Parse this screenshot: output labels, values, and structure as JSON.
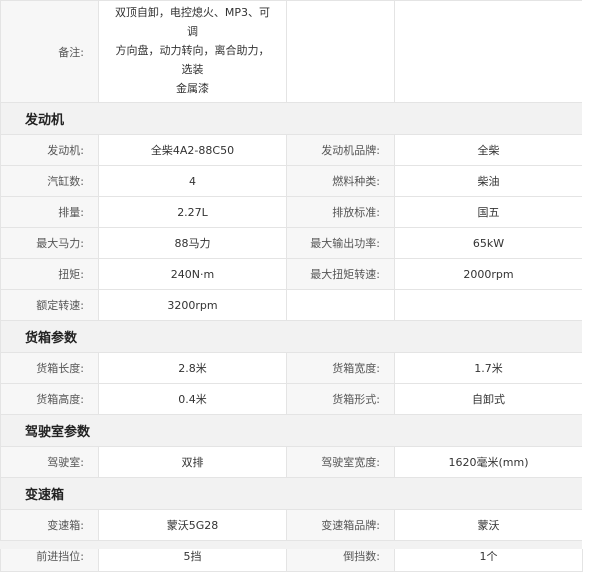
{
  "notes": {
    "label": "备注:",
    "lines": [
      "双顶自卸，电控熄火、MP3、可调",
      "方向盘，动力转向，离合助力，选装",
      "金属漆"
    ]
  },
  "engine": {
    "title": "发动机",
    "rows": [
      {
        "l1": "发动机:",
        "v1": "全柴4A2-88C50",
        "l2": "发动机品牌:",
        "v2": "全柴"
      },
      {
        "l1": "汽缸数:",
        "v1": "4",
        "l2": "燃料种类:",
        "v2": "柴油"
      },
      {
        "l1": "排量:",
        "v1": "2.27L",
        "l2": "排放标准:",
        "v2": "国五"
      },
      {
        "l1": "最大马力:",
        "v1": "88马力",
        "l2": "最大输出功率:",
        "v2": "65kW"
      },
      {
        "l1": "扭矩:",
        "v1": "240N·m",
        "l2": "最大扭矩转速:",
        "v2": "2000rpm"
      },
      {
        "l1": "额定转速:",
        "v1": "3200rpm",
        "l2": "",
        "v2": ""
      }
    ]
  },
  "cargo": {
    "title": "货箱参数",
    "rows": [
      {
        "l1": "货箱长度:",
        "v1": "2.8米",
        "l2": "货箱宽度:",
        "v2": "1.7米"
      },
      {
        "l1": "货箱高度:",
        "v1": "0.4米",
        "l2": "货箱形式:",
        "v2": "自卸式"
      }
    ]
  },
  "cab": {
    "title": "驾驶室参数",
    "rows": [
      {
        "l1": "驾驶室:",
        "v1": "双排",
        "l2": "驾驶室宽度:",
        "v2": "1620毫米(mm)"
      }
    ]
  },
  "gearbox": {
    "title": "变速箱",
    "rows": [
      {
        "l1": "变速箱:",
        "v1": "蒙沃5G28",
        "l2": "变速箱品牌:",
        "v2": "蒙沃"
      },
      {
        "l1": "前进挡位:",
        "v1": "5挡",
        "l2": "倒挡数:",
        "v2": "1个"
      }
    ]
  }
}
